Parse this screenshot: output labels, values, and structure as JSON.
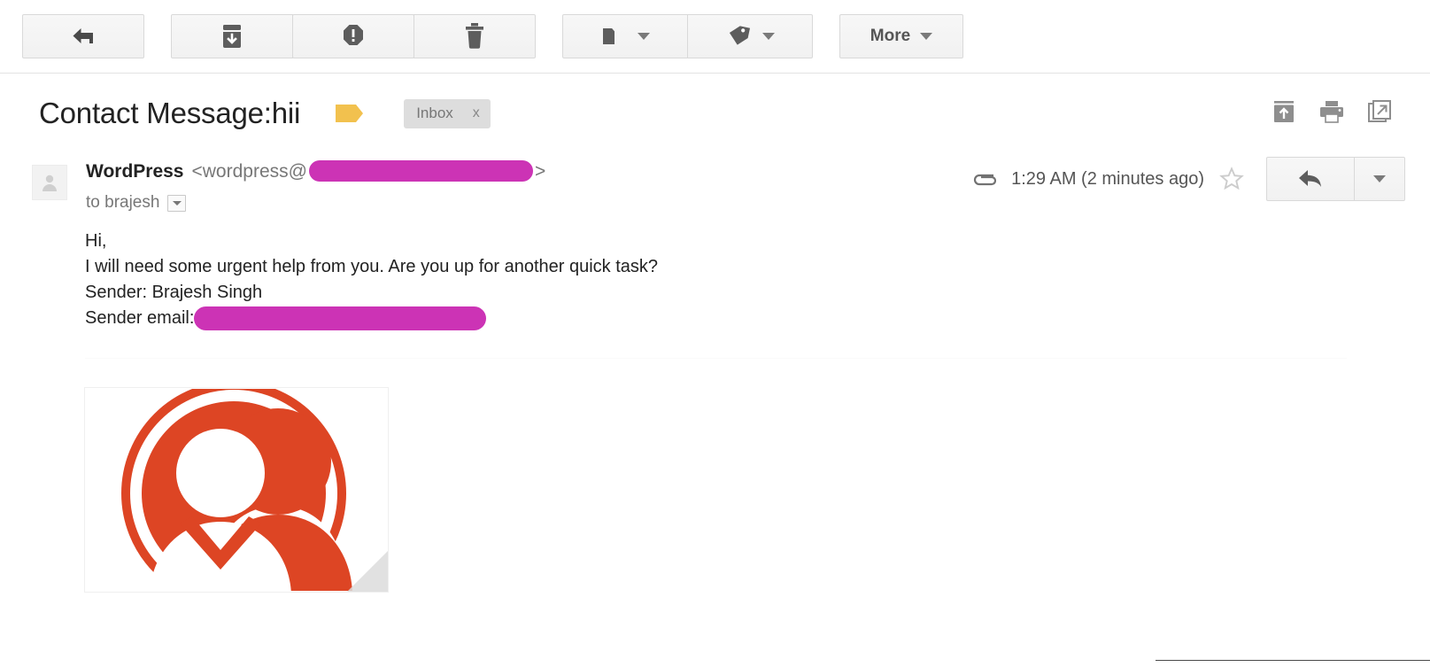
{
  "toolbar": {
    "buttons": [
      {
        "name": "archive-button",
        "icon": "archive-icon",
        "label": ""
      },
      {
        "name": "spam-button",
        "icon": "spam-icon",
        "label": ""
      },
      {
        "name": "delete-button",
        "icon": "trash-icon",
        "label": ""
      },
      {
        "name": "move-to-button",
        "icon": "folder-icon",
        "label": ""
      },
      {
        "name": "labels-button",
        "icon": "label-icon",
        "label": ""
      }
    ],
    "back_label": "",
    "more_label": "More"
  },
  "subject": {
    "title": "Contact Message:hii",
    "label_color": "#f2c14e",
    "chip_label": "Inbox",
    "chip_remove": "x"
  },
  "message": {
    "sender_name": "WordPress",
    "sender_email_prefix": "<wordpress@",
    "sender_email_suffix": ">",
    "to_line": "to brajesh",
    "time": "1:29 AM (2 minutes ago)",
    "redaction_color": "#cc33b5",
    "body_lines": [
      "Hi,",
      "I will need some urgent help from you. Are you up for another quick task?",
      "Sender: Brajesh Singh"
    ],
    "body_redacted_label": "Sender email:"
  },
  "attachment": {
    "alt": "contacts-group-logo",
    "color": "#dd4524"
  },
  "colors": {
    "accent_orange": "#dd4524",
    "label_yellow": "#f2c14e",
    "redaction_magenta": "#cc33b5",
    "chip_gray": "#dddddd"
  }
}
